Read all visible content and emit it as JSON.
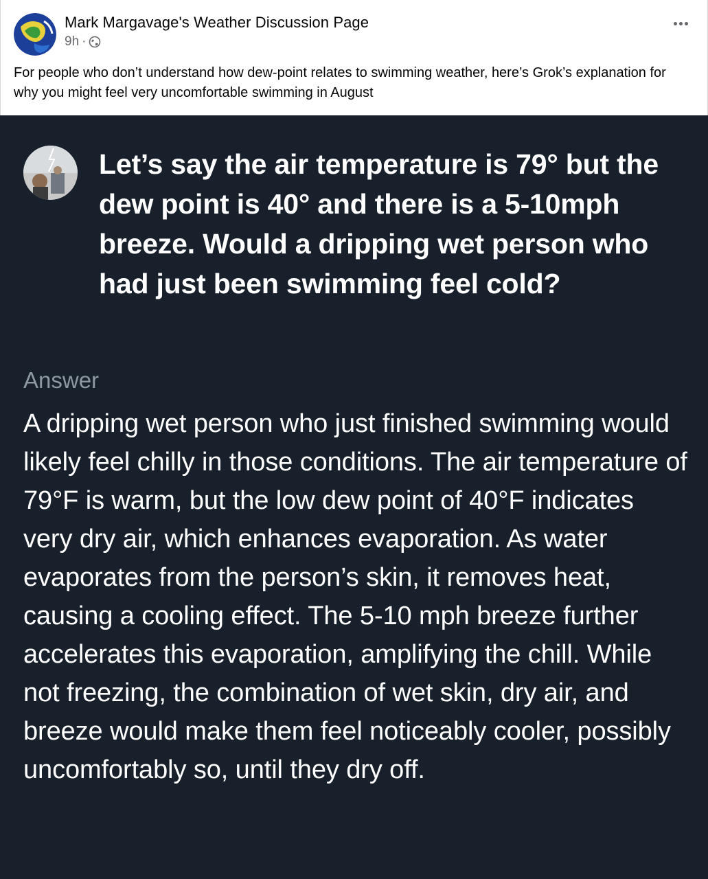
{
  "post": {
    "page_name": "Mark Margavage's Weather Discussion Page",
    "time": "9h",
    "separator": "·",
    "privacy_icon": "globe-icon",
    "more_icon": "more-options-icon",
    "caption": "For people who don’t understand how dew-point relates to swimming weather, here’s Grok’s explanation for why you might feel very uncomfortable swimming in August"
  },
  "image": {
    "question": "Let’s say the air temperature is 79° but the dew point is 40° and there is a 5-10mph breeze. Would a dripping wet person who had just been swimming feel cold?",
    "answer_label": "Answer",
    "answer": "A dripping wet person who just finished swimming would likely feel chilly in those conditions. The air temperature of 79°F is warm, but the low dew point of 40°F indicates very dry air, which enhances evaporation. As water evaporates from the person’s skin, it removes heat, causing a cooling effect. The 5-10 mph breeze further accelerates this evaporation, amplifying the chill. While not freezing, the combination of wet skin, dry air, and breeze would make them feel noticeably cooler, possibly uncomfortably so, until they dry off."
  },
  "colors": {
    "image_background": "#17202b",
    "answer_label": "#8e98a3",
    "meta_text": "#65676b"
  }
}
